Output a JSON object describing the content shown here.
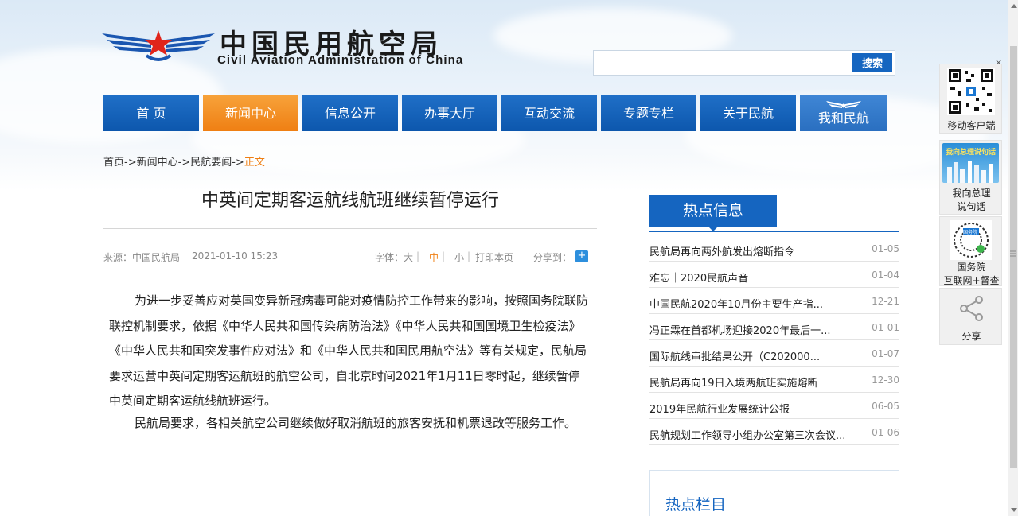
{
  "header": {
    "logo_cn": "中国民用航空局",
    "logo_en": "Civil Aviation Administration of China"
  },
  "search": {
    "value": "",
    "placeholder": "",
    "button_label": "搜索"
  },
  "nav": {
    "items": [
      {
        "label": "首 页"
      },
      {
        "label": "新闻中心"
      },
      {
        "label": "信息公开"
      },
      {
        "label": "办事大厅"
      },
      {
        "label": "互动交流"
      },
      {
        "label": "专题专栏"
      },
      {
        "label": "关于民航"
      },
      {
        "label": "我和民航"
      }
    ],
    "active_index": 1
  },
  "breadcrumb": {
    "items": [
      "首页",
      "新闻中心",
      "民航要闻"
    ],
    "separator": "->",
    "current": "正文"
  },
  "article": {
    "title": "中英间定期客运航线航班继续暂停运行",
    "source": "来源：中国民航局",
    "datetime": "2021-01-10 15:23",
    "font_size_label": "字体：",
    "font_sizes": [
      "大",
      "中",
      "小"
    ],
    "print_label": "打印本页",
    "share_label": "分享到：",
    "share_plus": "+",
    "paragraphs": [
      "为进一步妥善应对英国变异新冠病毒可能对疫情防控工作带来的影响，按照国务院联防联控机制要求，依据《中华人民共和国传染病防治法》《中华人民共和国国境卫生检疫法》《中华人民共和国突发事件应对法》和《中华人民共和国民用航空法》等有关规定，民航局要求运营中英间定期客运航班的航空公司，自北京时间2021年1月11日零时起，继续暂停中英间定期客运航线航班运行。",
      "民航局要求，各相关航空公司继续做好取消航班的旅客安抚和机票退改等服务工作。"
    ]
  },
  "hot_info": {
    "title": "热点信息",
    "items": [
      {
        "title": "民航局再向两外航发出熔断指令",
        "date": "01-05"
      },
      {
        "title": "难忘｜2020民航声音",
        "date": "01-04"
      },
      {
        "title": "中国民航2020年10月份主要生产指...",
        "date": "12-21"
      },
      {
        "title": "冯正霖在首都机场迎接2020年最后一...",
        "date": "01-01"
      },
      {
        "title": "国际航线审批结果公开（C202000...",
        "date": "01-07"
      },
      {
        "title": "民航局再向19日入境两航班实施熔断",
        "date": "12-30"
      },
      {
        "title": "2019年民航行业发展统计公报",
        "date": "06-05"
      },
      {
        "title": "民航规划工作领导小组办公室第三次会议...",
        "date": "01-06"
      }
    ]
  },
  "hot_columns": {
    "title": "热点栏目"
  },
  "side_float": {
    "close": "×",
    "items": [
      {
        "label": "移动客户端"
      },
      {
        "label": "我向总理\n说句话",
        "banner_text": "我向总理说句话"
      },
      {
        "label": "国务院\n互联网+督查",
        "badge": "国务院"
      },
      {
        "label": "分享"
      }
    ]
  },
  "colors": {
    "brand_blue": "#1565c0",
    "active_orange": "#ef7f13"
  }
}
